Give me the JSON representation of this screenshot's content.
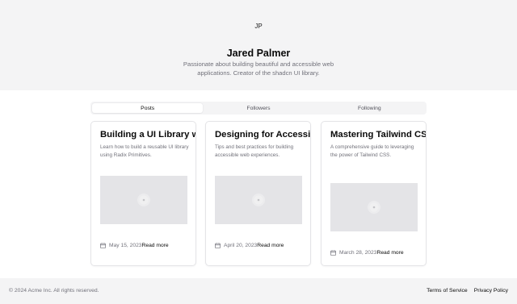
{
  "profile": {
    "avatar_initials": "JP",
    "name": "Jared Palmer",
    "bio": "Passionate about building beautiful and accessible web applications. Creator of the shadcn UI library."
  },
  "tabs": [
    {
      "label": "Posts",
      "active": true
    },
    {
      "label": "Followers",
      "active": false
    },
    {
      "label": "Following",
      "active": false
    }
  ],
  "posts": [
    {
      "title": "Building a UI Library with Radix",
      "description": "Learn how to build a reusable UI library using Radix Primitives.",
      "date": "May 15, 2023",
      "read_more": "Read more",
      "image_icon": "image-placeholder-icon"
    },
    {
      "title": "Designing for Accessibility",
      "description": "Tips and best practices for building accessible web experiences.",
      "date": "April 20, 2023",
      "read_more": "Read more",
      "image_icon": "image-placeholder-icon"
    },
    {
      "title": "Mastering Tailwind CSS",
      "description": "A comprehensive guide to leveraging the power of Tailwind CSS.",
      "date": "March 28, 2023",
      "read_more": "Read more",
      "image_icon": "image-placeholder-icon"
    }
  ],
  "footer": {
    "copyright": "© 2024 Acme Inc. All rights reserved.",
    "links": [
      "Terms of Service",
      "Privacy Policy"
    ]
  },
  "colors": {
    "hero_background": "#f4f4f5",
    "muted_text": "#71717a",
    "border": "#e4e4e7",
    "image_placeholder": "#e4e4e7"
  }
}
